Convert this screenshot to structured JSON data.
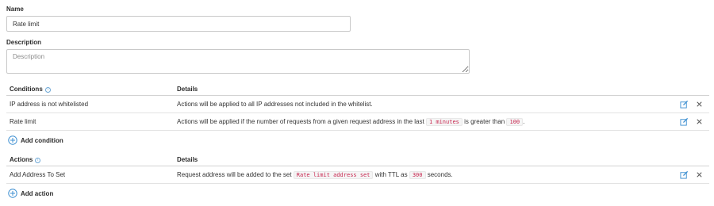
{
  "form": {
    "name_label": "Name",
    "name_value": "Rate limit",
    "description_label": "Description",
    "description_value": "",
    "description_placeholder": "Description"
  },
  "conditions": {
    "header": "Conditions",
    "details_header": "Details",
    "rows": [
      {
        "name": "IP address is not whitelisted",
        "details": [
          {
            "text": "Actions will be applied to all IP addresses not included in the whitelist."
          }
        ]
      },
      {
        "name": "Rate limit",
        "details": [
          {
            "text": "Actions will be applied if the number of requests from a given request address in the last "
          },
          {
            "code": "1 minutes"
          },
          {
            "text": " is greater than "
          },
          {
            "code": "100"
          },
          {
            "text": "."
          }
        ]
      }
    ],
    "add_label": "Add condition"
  },
  "actions": {
    "header": "Actions",
    "details_header": "Details",
    "rows": [
      {
        "name": "Add Address To Set",
        "details": [
          {
            "text": "Request address will be added to the set "
          },
          {
            "code": "Rate limit address set"
          },
          {
            "text": " with TTL as "
          },
          {
            "code": "300"
          },
          {
            "text": " seconds."
          }
        ]
      }
    ],
    "add_label": "Add action"
  },
  "colors": {
    "accent": "#3d8fd1",
    "code_text": "#c7254e",
    "code_bg": "#f5f5f5"
  },
  "icons": {
    "info": "info-icon",
    "edit": "edit-icon",
    "remove": "close-icon",
    "add": "plus-circle-icon"
  }
}
